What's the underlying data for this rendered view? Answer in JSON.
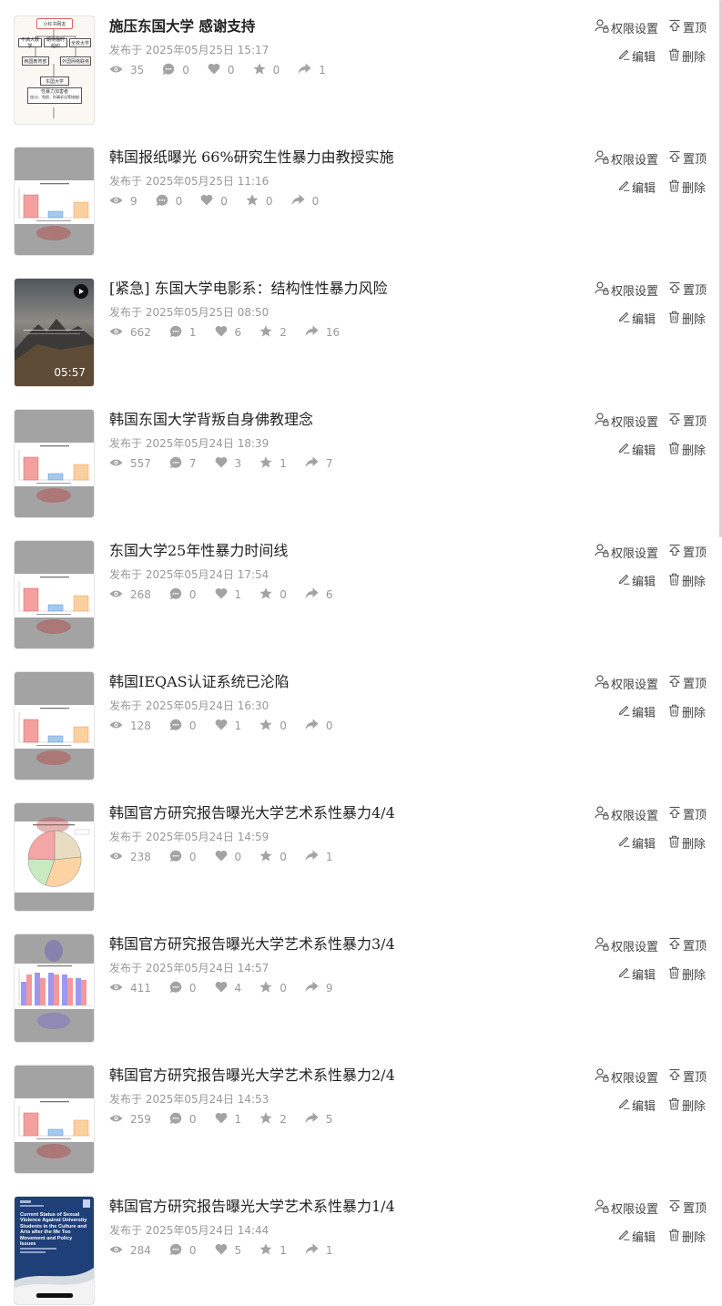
{
  "actions": {
    "permission": "权限设置",
    "pin": "置顶",
    "edit": "编辑",
    "delete": "删除"
  },
  "icons": [
    "eye-icon",
    "comment-icon",
    "heart-icon",
    "star-icon",
    "share-icon",
    "user-lock-icon",
    "pin-top-icon",
    "pencil-icon",
    "trash-icon",
    "play-icon"
  ],
  "colors": {
    "stat_gray": "#999999",
    "title": "#222222"
  },
  "posts": [
    {
      "title": "施压东国大学 感谢支持",
      "date": "发布于 2025年05月25日 15:17",
      "views": "35",
      "comments": "0",
      "likes": "0",
      "favorites": "0",
      "shares": "1",
      "thumb": {
        "type": "flowchart",
        "title": "小红书网友",
        "box1": "不满大教学",
        "box2": "期待临时组织",
        "box3": "全校大学",
        "box4": "韩国教育部",
        "box5": "外国网络联络",
        "box6": "东国大学",
        "box7": "性暴力加害者",
        "box7_sub": "(处分、免职、刑事诉讼等措施)"
      }
    },
    {
      "title": "韩国报纸曝光 66%研究生性暴力由教授实施",
      "date": "发布于 2025年05月25日 11:16",
      "views": "9",
      "comments": "0",
      "likes": "0",
      "favorites": "0",
      "shares": "0",
      "thumb": {
        "type": "bar"
      }
    },
    {
      "title": "[紧急] 东国大学电影系：结构性性暴力风险",
      "date": "发布于 2025年05月25日 08:50",
      "views": "662",
      "comments": "1",
      "likes": "6",
      "favorites": "2",
      "shares": "16",
      "thumb": {
        "type": "video",
        "duration": "05:57"
      }
    },
    {
      "title": "韩国东国大学背叛自身佛教理念",
      "date": "发布于 2025年05月24日 18:39",
      "views": "557",
      "comments": "7",
      "likes": "3",
      "favorites": "1",
      "shares": "7",
      "thumb": {
        "type": "bar"
      }
    },
    {
      "title": "东国大学25年性暴力时间线",
      "date": "发布于 2025年05月24日 17:54",
      "views": "268",
      "comments": "0",
      "likes": "1",
      "favorites": "0",
      "shares": "6",
      "thumb": {
        "type": "bar"
      }
    },
    {
      "title": "韩国IEQAS认证系统已沦陷",
      "date": "发布于 2025年05月24日 16:30",
      "views": "128",
      "comments": "0",
      "likes": "1",
      "favorites": "0",
      "shares": "0",
      "thumb": {
        "type": "bar"
      }
    },
    {
      "title": "韩国官方研究报告曝光大学艺术系性暴力4/4",
      "date": "发布于 2025年05月24日 14:59",
      "views": "238",
      "comments": "0",
      "likes": "0",
      "favorites": "0",
      "shares": "1",
      "thumb": {
        "type": "pie"
      }
    },
    {
      "title": "韩国官方研究报告曝光大学艺术系性暴力3/4",
      "date": "发布于 2025年05月24日 14:57",
      "views": "411",
      "comments": "0",
      "likes": "4",
      "favorites": "0",
      "shares": "9",
      "thumb": {
        "type": "grouped-bar"
      }
    },
    {
      "title": "韩国官方研究报告曝光大学艺术系性暴力2/4",
      "date": "发布于 2025年05月24日 14:53",
      "views": "259",
      "comments": "0",
      "likes": "1",
      "favorites": "2",
      "shares": "5",
      "thumb": {
        "type": "bar"
      }
    },
    {
      "title": "韩国官方研究报告曝光大学艺术系性暴力1/4",
      "date": "发布于 2025年05月24日 14:44",
      "views": "284",
      "comments": "0",
      "likes": "5",
      "favorites": "1",
      "shares": "1",
      "thumb": {
        "type": "cover",
        "heading": "Current Status of Sexual Violence Against University Students in the Culture and Arts after the Me Too Movement and Policy Issues"
      }
    }
  ]
}
